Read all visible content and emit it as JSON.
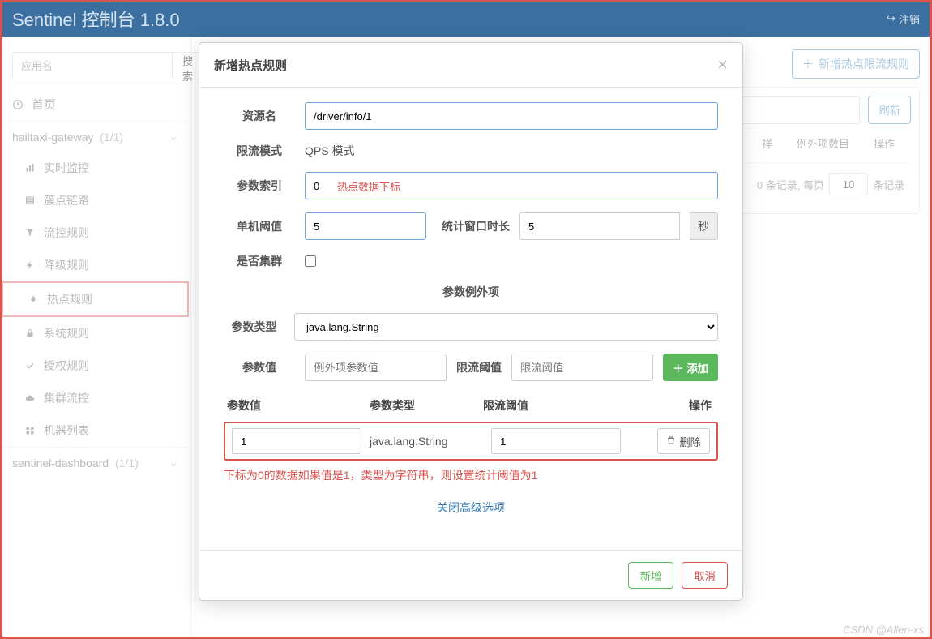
{
  "header": {
    "title": "Sentinel 控制台 1.8.0",
    "logout": "注销"
  },
  "sidebar": {
    "search_placeholder": "应用名",
    "search_btn": "搜索",
    "home": "首页",
    "groups": [
      {
        "name": "hailtaxi-gateway",
        "count": "(1/1)",
        "items": [
          {
            "label": "实时监控",
            "icon": "barchart"
          },
          {
            "label": "簇点链路",
            "icon": "list"
          },
          {
            "label": "流控规则",
            "icon": "filter"
          },
          {
            "label": "降级规则",
            "icon": "bolt"
          },
          {
            "label": "热点规则",
            "icon": "fire",
            "highlight": true
          },
          {
            "label": "系统规则",
            "icon": "lock"
          },
          {
            "label": "授权规则",
            "icon": "check"
          },
          {
            "label": "集群流控",
            "icon": "cloud"
          },
          {
            "label": "机器列表",
            "icon": "grid"
          }
        ]
      },
      {
        "name": "sentinel-dashboard",
        "count": "(1/1)"
      }
    ]
  },
  "main": {
    "add_btn": "新增热点限流规则",
    "refresh": "刷新",
    "table_head": {
      "c1": "祥",
      "c2": "例外项数目",
      "c3": "操作"
    },
    "pager": {
      "prefix": "0 条记录, 每页",
      "perpage": "10",
      "suffix": "条记录"
    }
  },
  "modal": {
    "title": "新增热点规则",
    "resource_label": "资源名",
    "resource_value": "/driver/info/1",
    "mode_label": "限流模式",
    "mode_value": "QPS 模式",
    "param_idx_label": "参数索引",
    "param_idx_value": "0",
    "idx_annot": "热点数据下标",
    "threshold_label": "单机阈值",
    "threshold_value": "5",
    "window_label": "统计窗口时长",
    "window_value": "5",
    "window_unit": "秒",
    "cluster_label": "是否集群",
    "except_section": "参数例外项",
    "param_type_label": "参数类型",
    "param_type_value": "java.lang.String",
    "param_val_label": "参数值",
    "param_val_placeholder": "例外项参数值",
    "flow_thresh_label": "限流阈值",
    "flow_thresh_placeholder": "限流阈值",
    "add_btn": "添加",
    "tbl_col1": "参数值",
    "tbl_col2": "参数类型",
    "tbl_col3": "限流阈值",
    "tbl_col4": "操作",
    "row_val": "1",
    "row_type": "java.lang.String",
    "row_thresh": "1",
    "del_btn": "删除",
    "row_annot": "下标为0的数据如果值是1，类型为字符串，则设置统计阈值为1",
    "close_adv": "关闭高级选项",
    "ok": "新增",
    "cancel": "取消"
  },
  "watermark": "CSDN @Allen-xs"
}
